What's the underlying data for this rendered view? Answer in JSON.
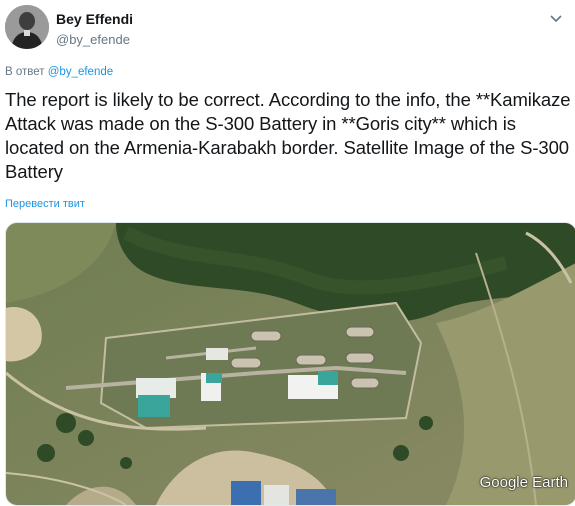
{
  "tweet": {
    "display_name": "Bey Effendi",
    "handle": "@by_efende",
    "reply_prefix": "В ответ",
    "reply_mention": "@by_efende",
    "text": "The report is likely to be correct. According to the info, the **Kamikaze Attack was made on the S-300 Battery in **Goris city** which is located on the Armenia-Karabakh border. Satellite Image of the S-300 Battery",
    "translate_link": "Перевести твит"
  },
  "media": {
    "watermark": "Google Earth"
  },
  "icons": {
    "avatar": "avatar-portrait",
    "menu": "chevron-down-icon"
  },
  "colors": {
    "link": "#1b95e0",
    "secondary_text": "#657786",
    "primary_text": "#14171a"
  }
}
